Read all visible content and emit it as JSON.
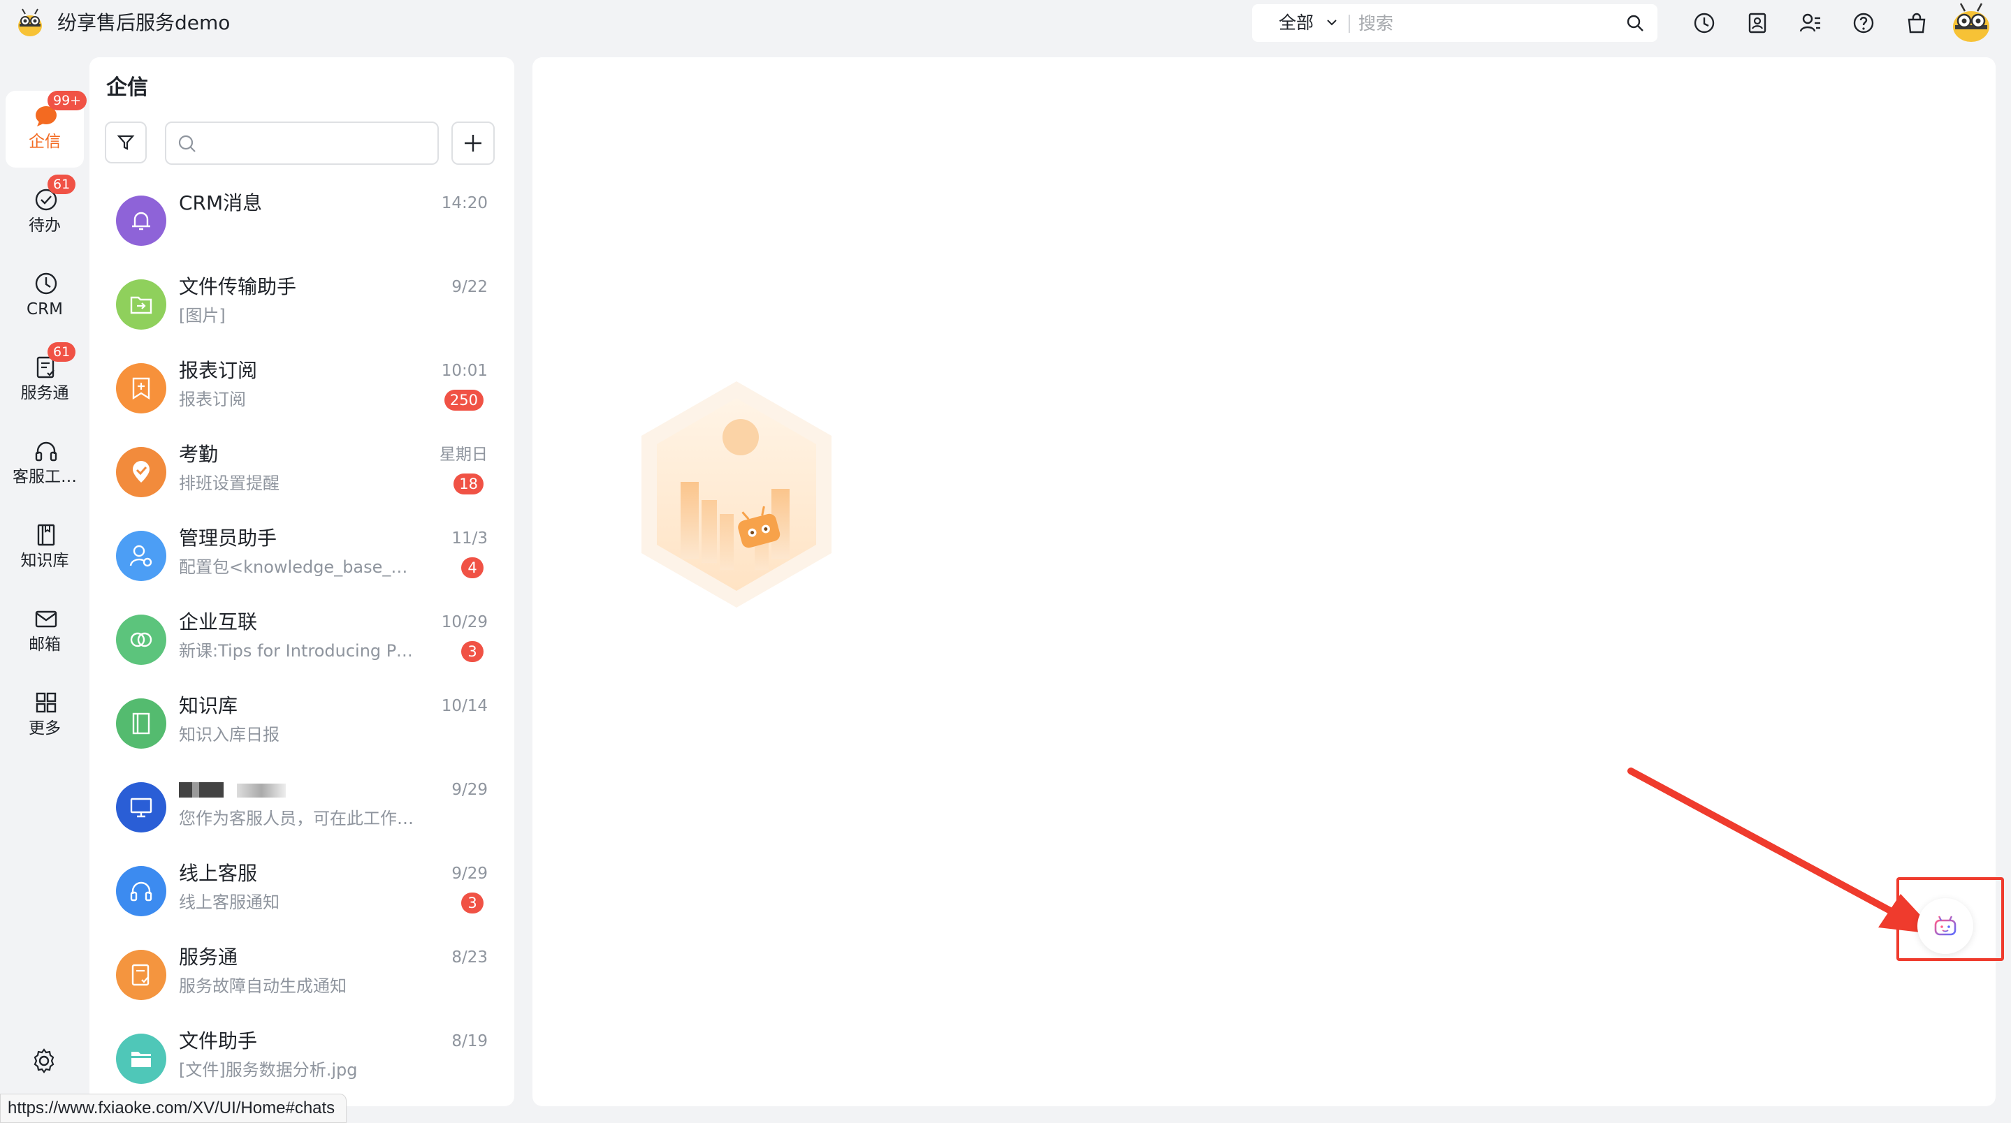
{
  "app": {
    "name": "纷享售后服务demo"
  },
  "search": {
    "scope": "全部",
    "placeholder": "搜索"
  },
  "nav": [
    {
      "label": "企信",
      "badge": "99+",
      "icon": "chat-bubble-icon",
      "active": true
    },
    {
      "label": "待办",
      "badge": "61",
      "icon": "check-circle-icon"
    },
    {
      "label": "CRM",
      "badge": "",
      "icon": "clock-icon"
    },
    {
      "label": "服务通",
      "badge": "61",
      "icon": "service-doc-icon"
    },
    {
      "label": "客服工…",
      "badge": "",
      "icon": "headset-icon"
    },
    {
      "label": "知识库",
      "badge": "",
      "icon": "book-icon"
    },
    {
      "label": "邮箱",
      "badge": "",
      "icon": "mail-icon"
    },
    {
      "label": "更多",
      "badge": "",
      "icon": "grid-icon"
    }
  ],
  "panel": {
    "title": "企信"
  },
  "chats": [
    {
      "name": "CRM消息",
      "preview": "",
      "time": "14:20",
      "badge": "",
      "color": "#8e63d8",
      "icon": "bell-icon"
    },
    {
      "name": "文件传输助手",
      "preview": "[图片]",
      "time": "9/22",
      "badge": "",
      "color": "#8fd05c",
      "icon": "folder-transfer-icon"
    },
    {
      "name": "报表订阅",
      "preview": "报表订阅",
      "time": "10:01",
      "badge": "250",
      "color": "#f7913b",
      "icon": "report-icon"
    },
    {
      "name": "考勤",
      "preview": "排班设置提醒",
      "time": "星期日",
      "badge": "18",
      "color": "#f28b3c",
      "icon": "attendance-icon"
    },
    {
      "name": "管理员助手",
      "preview": "配置包<knowledge_base_dat…",
      "time": "11/3",
      "badge": "4",
      "color": "#4c9ef5",
      "icon": "admin-icon"
    },
    {
      "name": "企业互联",
      "preview": "新课:Tips for Introducing Pro…",
      "time": "10/29",
      "badge": "3",
      "color": "#5cc47c",
      "icon": "link-icon"
    },
    {
      "name": "知识库",
      "preview": "知识入库日报",
      "time": "10/14",
      "badge": "",
      "color": "#54bb6f",
      "icon": "book-icon"
    },
    {
      "name": "",
      "preview": "您作为客服人员，可在此工作…",
      "time": "9/29",
      "badge": "",
      "color": "#2a5ed6",
      "icon": "monitor-icon"
    },
    {
      "name": "线上客服",
      "preview": "线上客服通知",
      "time": "9/29",
      "badge": "3",
      "color": "#3c8bf0",
      "icon": "headset-icon"
    },
    {
      "name": "服务通",
      "preview": "服务故障自动生成通知",
      "time": "8/23",
      "badge": "",
      "color": "#f4953f",
      "icon": "service-doc-icon"
    },
    {
      "name": "文件助手",
      "preview": "[文件]服务数据分析.jpg",
      "time": "8/19",
      "badge": "",
      "color": "#4fc7b8",
      "icon": "folder-icon"
    }
  ],
  "status": {
    "url": "https://www.fxiaoke.com/XV/UI/Home#chats"
  },
  "colors": {
    "accent": "#f36a21",
    "badge": "#f05245",
    "highlight": "#ef3b2d"
  }
}
